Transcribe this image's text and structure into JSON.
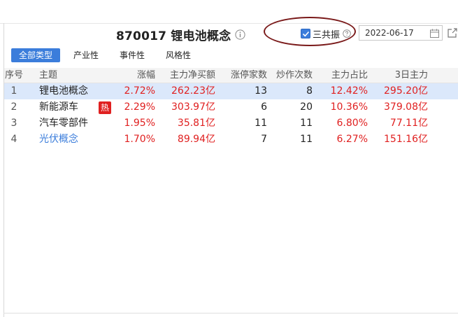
{
  "header": {
    "title": "870017 锂电池概念",
    "sgz_label": "三共振",
    "sgz_checked": true,
    "date": "2022-06-17"
  },
  "tabs": [
    {
      "label": "全部类型",
      "active": true
    },
    {
      "label": "产业性",
      "active": false
    },
    {
      "label": "事件性",
      "active": false
    },
    {
      "label": "风格性",
      "active": false
    }
  ],
  "table": {
    "columns": [
      "序号",
      "主题",
      "涨幅",
      "主力净买额",
      "涨停家数",
      "炒作次数",
      "主力占比",
      "3日主力"
    ],
    "rows": [
      {
        "no": "1",
        "name": "锂电池概念",
        "chg": "2.72%",
        "net": "262.23亿",
        "zt": "13",
        "cz": "8",
        "pct": "12.42%",
        "d3": "295.20亿",
        "hot": "",
        "selected": true,
        "link": false
      },
      {
        "no": "2",
        "name": "新能源车",
        "chg": "2.29%",
        "net": "303.97亿",
        "zt": "6",
        "cz": "20",
        "pct": "10.36%",
        "d3": "379.08亿",
        "hot": "热",
        "selected": false,
        "link": false
      },
      {
        "no": "3",
        "name": "汽车零部件",
        "chg": "1.95%",
        "net": "35.81亿",
        "zt": "11",
        "cz": "11",
        "pct": "6.80%",
        "d3": "77.11亿",
        "hot": "",
        "selected": false,
        "link": false
      },
      {
        "no": "4",
        "name": "光伏概念",
        "chg": "1.70%",
        "net": "89.94亿",
        "zt": "7",
        "cz": "11",
        "pct": "6.27%",
        "d3": "151.16亿",
        "hot": "",
        "selected": false,
        "link": true
      }
    ]
  },
  "colors": {
    "accent": "#3b7ddb",
    "up": "#e02020",
    "selected_row": "#dbe8fb",
    "annotation_oval": "#7a1a1a"
  },
  "icons": {
    "info": "info-icon",
    "help": "question-icon",
    "calendar": "calendar-icon",
    "export": "export-icon"
  }
}
